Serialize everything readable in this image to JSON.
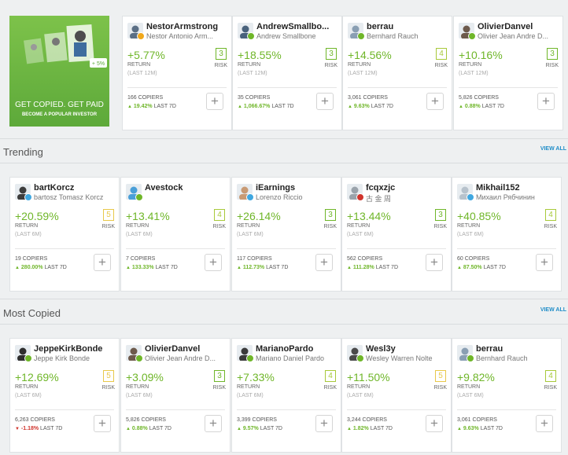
{
  "promo": {
    "headline": "GET COPIED. GET PAID",
    "subline": "BECOME A POPULAR INVESTOR",
    "bubble": "+ 5%"
  },
  "sections": [
    {
      "title": "",
      "view_all": "",
      "cards": [
        {
          "username": "NestorArmstrong",
          "fullname": "Nestor Antonio Arm...",
          "return": "+5.77%",
          "return_label": "RETURN",
          "period": "(LAST 12M)",
          "risk": "3",
          "risk_label": "RISK",
          "risk_color": "#6fb629",
          "copiers": "166 COPIERS",
          "change": "19.42%",
          "change_dir": "up",
          "change_label": "LAST 7D",
          "avatar_color": "#5b6f85",
          "badge_color": "#f0a81c"
        },
        {
          "username": "AndrewSmallbo...",
          "fullname": "Andrew Smallbone",
          "return": "+18.55%",
          "return_label": "RETURN",
          "period": "(LAST 12M)",
          "risk": "3",
          "risk_label": "RISK",
          "risk_color": "#6fb629",
          "copiers": "35 COPIERS",
          "change": "1,066.67%",
          "change_dir": "up",
          "change_label": "LAST 7D",
          "avatar_color": "#49627c",
          "badge_color": "#6fb629"
        },
        {
          "username": "berrau",
          "fullname": "Bernhard Rauch",
          "return": "+14.56%",
          "return_label": "RETURN",
          "period": "(LAST 12M)",
          "risk": "4",
          "risk_label": "RISK",
          "risk_color": "#a8c93a",
          "copiers": "3,061 COPIERS",
          "change": "9.63%",
          "change_dir": "up",
          "change_label": "LAST 7D",
          "avatar_color": "#8a9fb3",
          "badge_color": "#6fb629"
        },
        {
          "username": "OlivierDanvel",
          "fullname": "Olivier Jean Andre D...",
          "return": "+10.16%",
          "return_label": "RETURN",
          "period": "(LAST 12M)",
          "risk": "3",
          "risk_label": "RISK",
          "risk_color": "#6fb629",
          "copiers": "5,826 COPIERS",
          "change": "0.88%",
          "change_dir": "up",
          "change_label": "LAST 7D",
          "avatar_color": "#6d5a4c",
          "badge_color": "#6fb629"
        }
      ]
    },
    {
      "title": "Trending",
      "view_all": "VIEW ALL",
      "cards": [
        {
          "username": "bartKorcz",
          "fullname": "bartosz Tomasz Korcz",
          "return": "+20.59%",
          "return_label": "RETURN",
          "period": "(LAST 6M)",
          "risk": "5",
          "risk_label": "RISK",
          "risk_color": "#e8c84a",
          "copiers": "19 COPIERS",
          "change": "280.00%",
          "change_dir": "up",
          "change_label": "LAST 7D",
          "avatar_color": "#3d3d3d",
          "badge_color": "#3fa7e0"
        },
        {
          "username": "Avestock",
          "fullname": "",
          "return": "+13.41%",
          "return_label": "RETURN",
          "period": "(LAST 6M)",
          "risk": "4",
          "risk_label": "RISK",
          "risk_color": "#a8c93a",
          "copiers": "7 COPIERS",
          "change": "133.33%",
          "change_dir": "up",
          "change_label": "LAST 7D",
          "avatar_color": "#4a9fd8",
          "badge_color": "#6fb629"
        },
        {
          "username": "iEarnings",
          "fullname": "Lorenzo Riccio",
          "return": "+26.14%",
          "return_label": "RETURN",
          "period": "(LAST 6M)",
          "risk": "3",
          "risk_label": "RISK",
          "risk_color": "#6fb629",
          "copiers": "117 COPIERS",
          "change": "112.73%",
          "change_dir": "up",
          "change_label": "LAST 7D",
          "avatar_color": "#c89a74",
          "badge_color": "#3fa7e0"
        },
        {
          "username": "fcqxzjc",
          "fullname": "古 金 周",
          "return": "+13.44%",
          "return_label": "RETURN",
          "period": "(LAST 6M)",
          "risk": "3",
          "risk_label": "RISK",
          "risk_color": "#6fb629",
          "copiers": "562 COPIERS",
          "change": "111.28%",
          "change_dir": "up",
          "change_label": "LAST 7D",
          "avatar_color": "#9aa3ab",
          "badge_color": "#d0342c"
        },
        {
          "username": "Mikhail152",
          "fullname": "Михаил Рябчинин",
          "return": "+40.85%",
          "return_label": "RETURN",
          "period": "(LAST 6M)",
          "risk": "4",
          "risk_label": "RISK",
          "risk_color": "#a8c93a",
          "copiers": "60 COPIERS",
          "change": "87.50%",
          "change_dir": "up",
          "change_label": "LAST 7D",
          "avatar_color": "#b7c2cc",
          "badge_color": "#3fa7e0"
        }
      ]
    },
    {
      "title": "Most Copied",
      "view_all": "VIEW ALL",
      "cards": [
        {
          "username": "JeppeKirkBonde",
          "fullname": "Jeppe Kirk Bonde",
          "return": "+12.69%",
          "return_label": "RETURN",
          "period": "(LAST 6M)",
          "risk": "5",
          "risk_label": "RISK",
          "risk_color": "#e8c84a",
          "copiers": "6,263 COPIERS",
          "change": "-1.18%",
          "change_dir": "down",
          "change_label": "LAST 7D",
          "avatar_color": "#2e2e2e",
          "badge_color": "#6fb629"
        },
        {
          "username": "OlivierDanvel",
          "fullname": "Olivier Jean Andre D...",
          "return": "+3.09%",
          "return_label": "RETURN",
          "period": "(LAST 6M)",
          "risk": "3",
          "risk_label": "RISK",
          "risk_color": "#6fb629",
          "copiers": "5,826 COPIERS",
          "change": "0.88%",
          "change_dir": "up",
          "change_label": "LAST 7D",
          "avatar_color": "#6d5a4c",
          "badge_color": "#6fb629"
        },
        {
          "username": "MarianoPardo",
          "fullname": "Mariano Daniel Pardo",
          "return": "+7.33%",
          "return_label": "RETURN",
          "period": "(LAST 6M)",
          "risk": "4",
          "risk_label": "RISK",
          "risk_color": "#a8c93a",
          "copiers": "3,399 COPIERS",
          "change": "9.57%",
          "change_dir": "up",
          "change_label": "LAST 7D",
          "avatar_color": "#3b3b3b",
          "badge_color": "#6fb629"
        },
        {
          "username": "Wesl3y",
          "fullname": "Wesley Warren Nolte",
          "return": "+11.50%",
          "return_label": "RETURN",
          "period": "(LAST 6M)",
          "risk": "5",
          "risk_label": "RISK",
          "risk_color": "#e8c84a",
          "copiers": "3,244 COPIERS",
          "change": "1.82%",
          "change_dir": "up",
          "change_label": "LAST 7D",
          "avatar_color": "#4a4a4a",
          "badge_color": "#6fb629"
        },
        {
          "username": "berrau",
          "fullname": "Bernhard Rauch",
          "return": "+9.82%",
          "return_label": "RETURN",
          "period": "(LAST 6M)",
          "risk": "4",
          "risk_label": "RISK",
          "risk_color": "#a8c93a",
          "copiers": "3,061 COPIERS",
          "change": "9.63%",
          "change_dir": "up",
          "change_label": "LAST 7D",
          "avatar_color": "#8a9fb3",
          "badge_color": "#6fb629"
        }
      ]
    }
  ]
}
